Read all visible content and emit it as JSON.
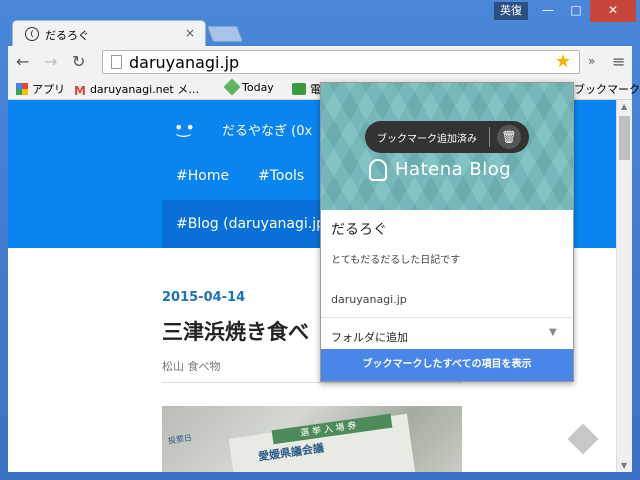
{
  "window": {
    "ime_label": "英復",
    "minimize_glyph": "—",
    "maximize_glyph": "□",
    "close_glyph": "✕"
  },
  "tab": {
    "title": "だるろぐ",
    "close_glyph": "×"
  },
  "toolbar": {
    "url": "daruyanagi.jp",
    "back_glyph": "←",
    "forward_glyph": "→",
    "reload_glyph": "↻",
    "star_glyph": "★",
    "extensions_glyph": "»",
    "menu_glyph": "≡",
    "accent_star_color": "#f0b400"
  },
  "bookmarks_bar": {
    "items": [
      {
        "label": "アプリ",
        "icon": "apps-icon"
      },
      {
        "label": "daruyanagi.net メ…",
        "icon": "gmail-icon"
      },
      {
        "label": "Today",
        "icon": "today-icon"
      },
      {
        "label": "電",
        "icon": "green-icon"
      }
    ],
    "more_label": "ブックマーク"
  },
  "page": {
    "face": "•͜•",
    "site_name": "だるやなぎ (0x",
    "nav": {
      "home": "#Home",
      "tools": "#Tools",
      "blog": "#Blog (daruyanagi.jp"
    },
    "post": {
      "date": "2015-04-14",
      "title": "三津浜焼き食べ",
      "categories": "松山 食べ物",
      "image_band_text": "選 挙 入 場 券",
      "image_main_text": "愛媛県議会議",
      "image_corner_text": "投票日"
    },
    "header_color": "#0a84f0"
  },
  "popup": {
    "pill_text": "ブックマーク追加済み",
    "trash_glyph": "🗑",
    "hero_text": "Hatena Blog",
    "title": "だるろぐ",
    "description": "とてもだるだるした日記です",
    "url": "daruyanagi.jp",
    "folder_label": "フォルダに追加",
    "folder_chevron": "▼",
    "show_all_label": "ブックマークしたすべての項目を表示",
    "button_color": "#4a86e8"
  }
}
